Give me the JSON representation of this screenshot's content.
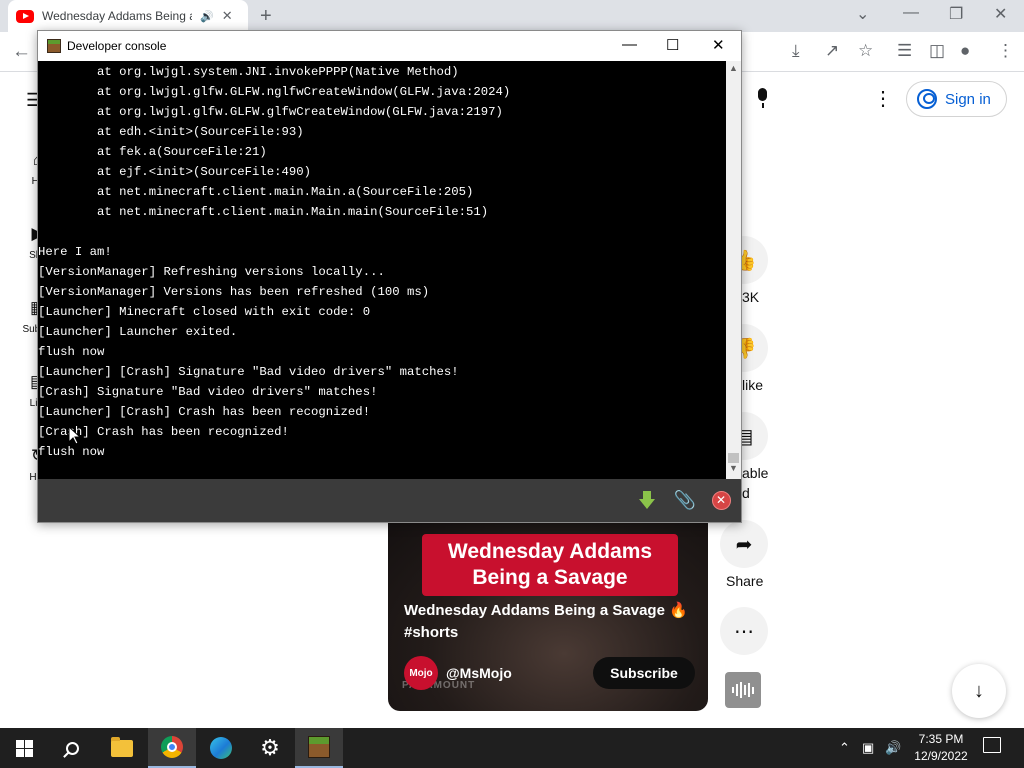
{
  "browser": {
    "tab_title": "Wednesday Addams Being a Savage",
    "new_tab": "+",
    "sign_in": "Sign in"
  },
  "yt_nav": [
    {
      "label": "Ho",
      "icon": "home-icon"
    },
    {
      "label": "Sho",
      "icon": "shorts-icon"
    },
    {
      "label": "Subscr",
      "icon": "subscriptions-icon"
    },
    {
      "label": "Libr",
      "icon": "library-icon"
    },
    {
      "label": "Hist",
      "icon": "history-icon"
    }
  ],
  "actions": {
    "like_count": "3K",
    "dislike_label": "like",
    "comments_label_1": "able",
    "comments_label_2": "d",
    "share_label": "Share"
  },
  "video": {
    "banner_line1": "Wednesday Addams",
    "banner_line2": "Being a Savage",
    "title_line1": "Wednesday Addams Being a Savage",
    "title_emoji": "🔥",
    "title_line2": "#shorts",
    "channel": "@MsMojo",
    "avatar_text": "Mojo",
    "subscribe": "Subscribe",
    "watermark": "PARAMOUNT"
  },
  "console": {
    "title": "Developer console",
    "lines": [
      "        at org.lwjgl.system.JNI.invokePPPP(Native Method)",
      "        at org.lwjgl.glfw.GLFW.nglfwCreateWindow(GLFW.java:2024)",
      "        at org.lwjgl.glfw.GLFW.glfwCreateWindow(GLFW.java:2197)",
      "        at edh.<init>(SourceFile:93)",
      "        at fek.a(SourceFile:21)",
      "        at ejf.<init>(SourceFile:490)",
      "        at net.minecraft.client.main.Main.a(SourceFile:205)",
      "        at net.minecraft.client.main.Main.main(SourceFile:51)",
      "",
      "Here I am!",
      "[VersionManager] Refreshing versions locally...",
      "[VersionManager] Versions has been refreshed (100 ms)",
      "[Launcher] Minecraft closed with exit code: 0",
      "[Launcher] Launcher exited.",
      "flush now",
      "[Launcher] [Crash] Signature \"Bad video drivers\" matches!",
      "[Crash] Signature \"Bad video drivers\" matches!",
      "[Launcher] [Crash] Crash has been recognized!",
      "[Crash] Crash has been recognized!",
      "flush now"
    ]
  },
  "taskbar": {
    "time": "7:35 PM",
    "date": "12/9/2022"
  },
  "colors": {
    "yt_red": "#ff0000",
    "sign_in_blue": "#065fd4",
    "console_bg": "#000000",
    "console_footer": "#3b3b3b",
    "taskbar": "#1f1f1f"
  }
}
